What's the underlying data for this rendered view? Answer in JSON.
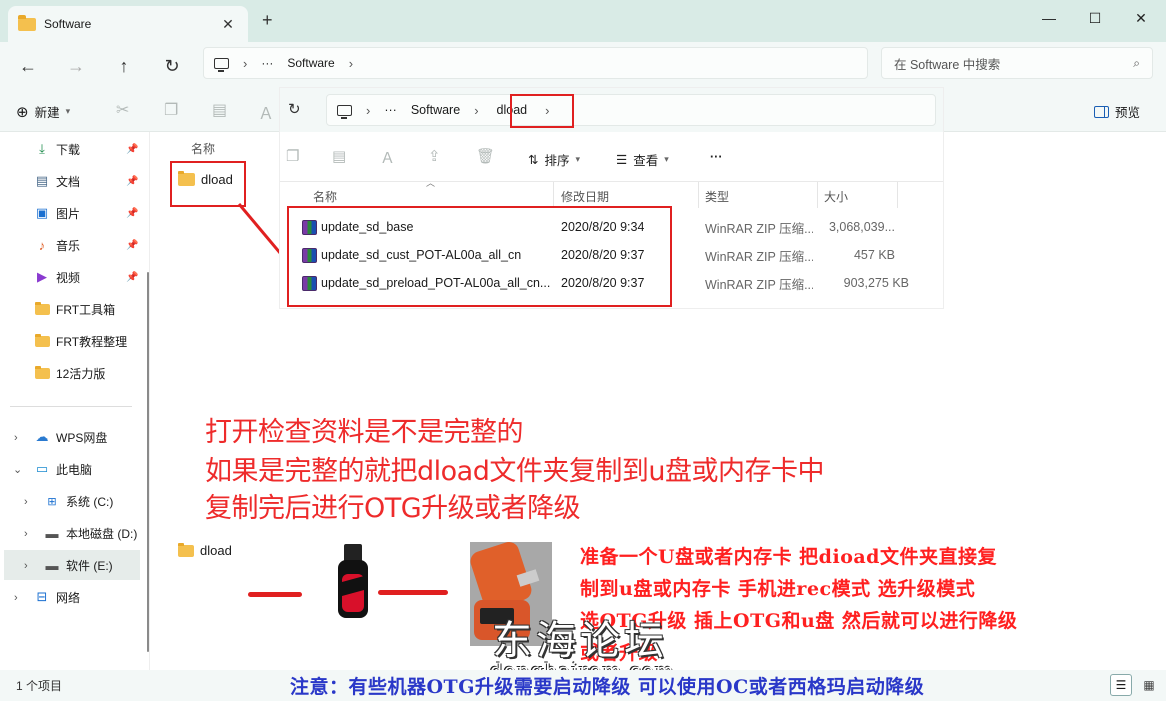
{
  "window": {
    "tab_title": "Software",
    "tab_close": "✕",
    "tab_new": "+",
    "minimize": "—",
    "maximize": "☐",
    "close": "✕"
  },
  "address": {
    "crumb_more": "···",
    "crumb_software": "Software",
    "search_placeholder": "在 Software 中搜索"
  },
  "toolbar": {
    "new_label": "新建",
    "preview_label": "预览"
  },
  "sidebar": {
    "quick": [
      {
        "label": "下载",
        "icon": "download-icon"
      },
      {
        "label": "文档",
        "icon": "document-icon"
      },
      {
        "label": "图片",
        "icon": "picture-icon"
      },
      {
        "label": "音乐",
        "icon": "music-icon"
      },
      {
        "label": "视频",
        "icon": "video-icon"
      },
      {
        "label": "FRT工具箱",
        "icon": "folder-icon"
      },
      {
        "label": "FRT教程整理",
        "icon": "folder-icon"
      },
      {
        "label": "12活力版",
        "icon": "folder-icon"
      }
    ],
    "tree": [
      {
        "label": "WPS网盘",
        "icon": "cloud-icon"
      },
      {
        "label": "此电脑",
        "icon": "pc-icon"
      },
      {
        "label": "系统 (C:)",
        "icon": "windows-drive-icon"
      },
      {
        "label": "本地磁盘 (D:)",
        "icon": "drive-icon"
      },
      {
        "label": "软件 (E:)",
        "icon": "drive-icon"
      },
      {
        "label": "网络",
        "icon": "network-icon"
      }
    ]
  },
  "content": {
    "column_name": "名称",
    "folder_name": "dload"
  },
  "overlay": {
    "crumb_more": "···",
    "crumb_software": "Software",
    "crumb_dload": "dload",
    "sort_label": "排序",
    "view_label": "查看",
    "more_label": "···",
    "headers": {
      "name": "名称",
      "date": "修改日期",
      "type": "类型",
      "size": "大小"
    },
    "files": [
      {
        "name": "update_sd_base",
        "date": "2020/8/20 9:34",
        "type": "WinRAR ZIP 压缩...",
        "size": "3,068,039..."
      },
      {
        "name": "update_sd_cust_POT-AL00a_all_cn",
        "date": "2020/8/20 9:37",
        "type": "WinRAR ZIP 压缩...",
        "size": "457 KB"
      },
      {
        "name": "update_sd_preload_POT-AL00a_all_cn...",
        "date": "2020/8/20 9:37",
        "type": "WinRAR ZIP 压缩...",
        "size": "903,275 KB"
      }
    ]
  },
  "annotation": {
    "line1": "打开检查资料是不是完整的",
    "line2": "如果是完整的就把dload文件夹复制到u盘或内存卡中",
    "line3": "复制完后进行OTG升级或者降级",
    "bottom_folder": "dload",
    "instr1": "准备一个U盘或者内存卡 把dioad文件夹直接复",
    "instr2": "制到u盘或内存卡 手机进rec模式 选升级模式",
    "instr3": "选OTG升级 插上OTG和u盘 然后就可以进行降级",
    "instr4": "或者升级",
    "footer": "注意：有些机器OTG升级需要启动降级 可以使用OC或者西格玛启动降级",
    "watermark": "东海论坛",
    "watermark_sub": "donghairom.com"
  },
  "status": {
    "count": "1 个项目"
  },
  "colors": {
    "accent_red": "#e02020",
    "annotation_blue": "#2a38c8",
    "folder_yellow": "#f4c04e"
  }
}
